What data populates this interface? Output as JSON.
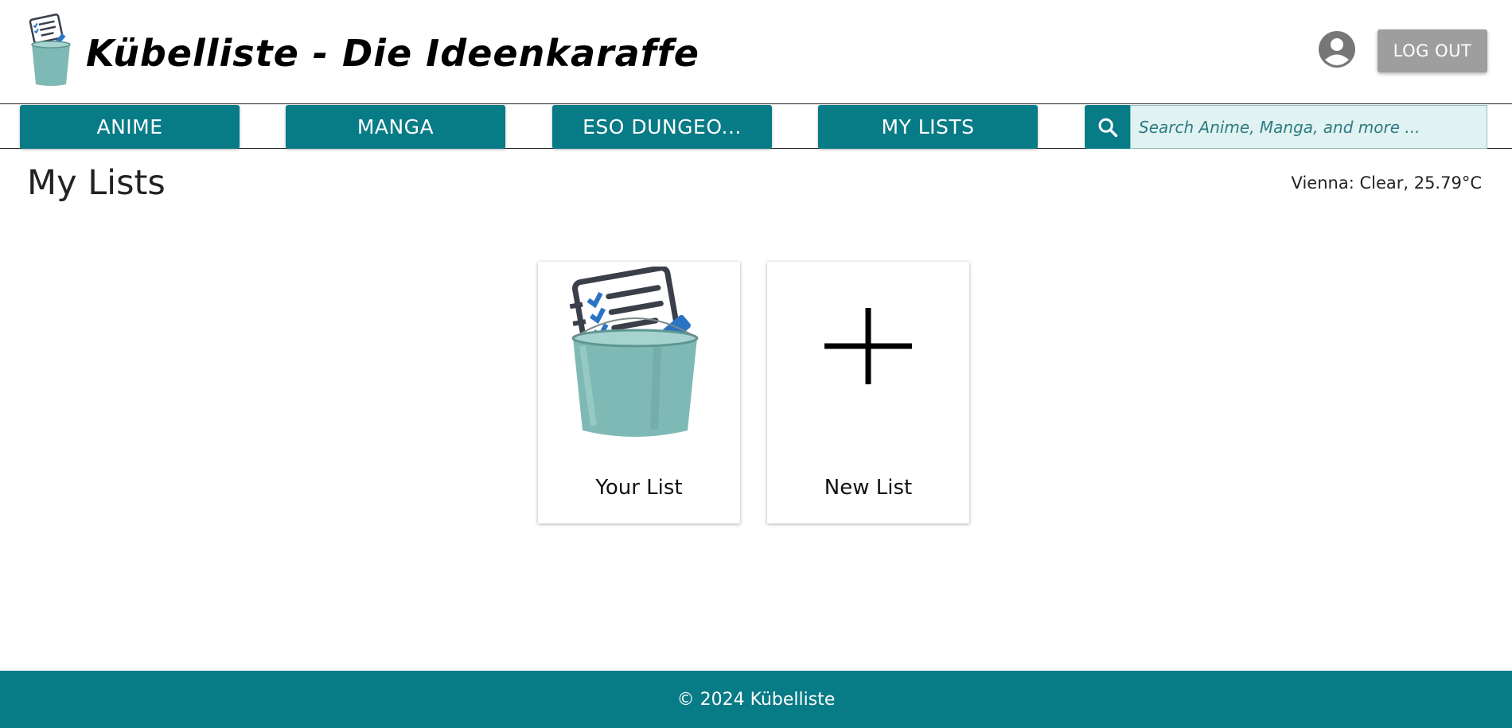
{
  "header": {
    "title": "Kübelliste - Die Ideenkaraffe",
    "logout_label": "LOG OUT",
    "account_icon": "account-circle-icon",
    "logo_icon": "bucket-list-icon"
  },
  "nav": {
    "items": [
      {
        "label": "ANIME"
      },
      {
        "label": "MANGA"
      },
      {
        "label": "ESO DUNGEO..."
      },
      {
        "label": "MY LISTS"
      }
    ],
    "search": {
      "placeholder": "Search Anime, Manga, and more ...",
      "value": "",
      "icon": "search-icon"
    }
  },
  "main": {
    "title": "My Lists",
    "weather": "Vienna: Clear, 25.79°C",
    "cards": [
      {
        "label": "Your List",
        "icon": "bucket-list-icon"
      },
      {
        "label": "New List",
        "icon": "plus-icon"
      }
    ]
  },
  "footer": {
    "text": "© 2024 Kübelliste"
  },
  "colors": {
    "primary": "#077b86",
    "search_bg": "#e0f2f1",
    "logout_bg": "#9e9e9e",
    "account_icon": "#777777"
  }
}
